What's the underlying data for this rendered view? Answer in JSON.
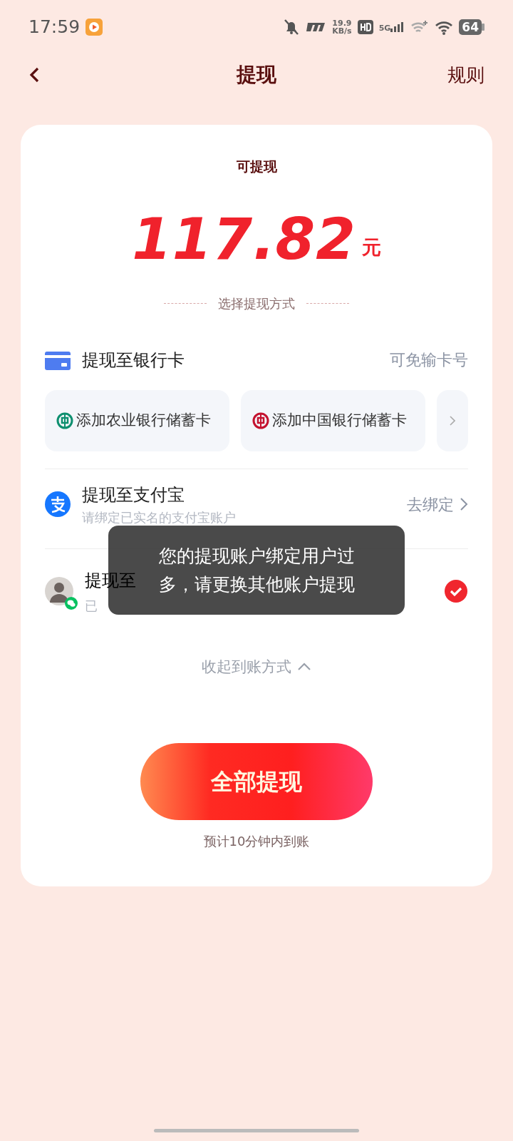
{
  "status_bar": {
    "time": "17:59",
    "speed": "19.9",
    "speed_unit": "KB/s",
    "network": "5G",
    "battery": "64"
  },
  "header": {
    "title": "提现",
    "action": "规则"
  },
  "balance": {
    "label": "可提现",
    "amount": "117.82",
    "unit": "元"
  },
  "method_divider": "选择提现方式",
  "methods": [
    {
      "kind": "bank",
      "title": "提现至银行卡",
      "hint": "可免输卡号",
      "selected": false,
      "cards": [
        {
          "label": "添加农业银行储蓄卡",
          "color": "#0e8f6f"
        },
        {
          "label": "添加中国银行储蓄卡",
          "color": "#c4122f"
        }
      ]
    },
    {
      "kind": "alipay",
      "title": "提现至支付宝",
      "subtitle": "请绑定已实名的支付宝账户",
      "action": "去绑定",
      "selected": false
    },
    {
      "kind": "wechat",
      "title": "提现至",
      "bound_label": "已",
      "selected": true
    }
  ],
  "collapse": "收起到账方式",
  "submit": {
    "label": "全部提现",
    "note": "预计10分钟内到账"
  },
  "toast": "您的提现账户绑定用户过多，请更换其他账户提现"
}
